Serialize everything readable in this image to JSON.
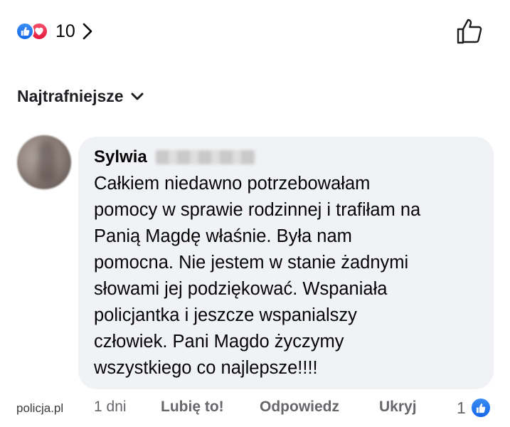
{
  "post_reactions": {
    "count": "10",
    "icons": [
      "like-icon",
      "love-icon"
    ]
  },
  "like_button_icon": "thumbs-up-outline-icon",
  "sort": {
    "label": "Najtrafniejsze",
    "icon": "chevron-down-icon"
  },
  "comment": {
    "author_first_name": "Sylwia",
    "text": "Całkiem niedawno potrzebowałam\npomocy w sprawie rodzinnej i trafiłam na\nPanią Magdę właśnie. Była nam\npomocna.  Nie jestem w stanie żadnymi\nsłowami jej podziękować. Wspaniała\npolicjantka i jeszcze wspanialszy\nczłowiek. Pani Magdo życzymy\nwszystkiego co najlepsze!!!!",
    "time": "1 dni",
    "like_label": "Lubię to!",
    "reply_label": "Odpowiedz",
    "hide_label": "Ukryj",
    "reaction_count": "1"
  },
  "watermark": "policja.pl",
  "colors": {
    "like_blue": "#1877f2",
    "love_red": "#f33e58",
    "bubble_bg": "#f0f2f5",
    "meta_gray": "#65676b"
  }
}
